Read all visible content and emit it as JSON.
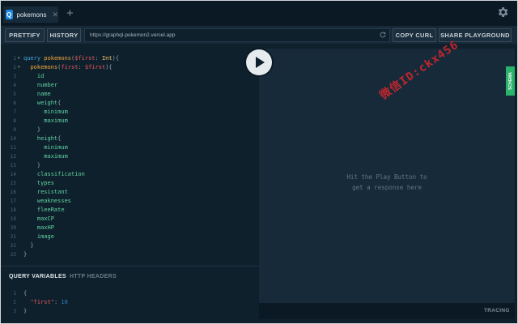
{
  "tab": {
    "icon_letter": "Q",
    "label": "pokemons",
    "close": "✕",
    "add": "+"
  },
  "toolbar": {
    "prettify": "PRETTIFY",
    "history": "HISTORY",
    "url": "https://graphql-pokemon2.vercel.app",
    "copy_curl": "COPY CURL",
    "share": "SHARE PLAYGROUND"
  },
  "editor": {
    "line_numbers": [
      "1",
      "2",
      "3",
      "4",
      "5",
      "6",
      "7",
      "8",
      "9",
      "10",
      "11",
      "12",
      "13",
      "14",
      "15",
      "16",
      "17",
      "18",
      "19",
      "20",
      "21",
      "22",
      "23"
    ],
    "fold_markers": [
      "▾",
      "▾"
    ]
  },
  "result": {
    "hint_line1": "Hit the Play Button to",
    "hint_line2": "get a response here",
    "watermark": "微信ID:ckx456"
  },
  "schema_tab": "SCHEMA",
  "variables": {
    "tab_query": "QUERY VARIABLES",
    "tab_headers": "HTTP HEADERS",
    "line_numbers": [
      "1",
      "2",
      "3"
    ]
  },
  "footer": {
    "tracing": "TRACING"
  },
  "colors": {
    "accent_blue": "#1e88e5",
    "schema_green": "#29b36b",
    "watermark_red": "#d0262b"
  }
}
